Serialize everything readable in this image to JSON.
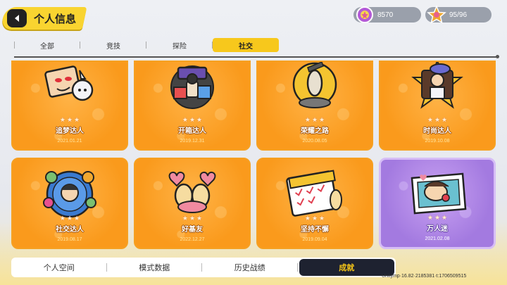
{
  "header": {
    "title": "个人信息"
  },
  "resources": [
    {
      "icon": "gem-badge-icon",
      "value": "8570"
    },
    {
      "icon": "star-token-icon",
      "value": "95/96"
    }
  ],
  "tabs": [
    {
      "label": "全部",
      "active": false
    },
    {
      "label": "竞技",
      "active": false
    },
    {
      "label": "探险",
      "active": false
    },
    {
      "label": "社交",
      "active": true
    }
  ],
  "achievements": [
    {
      "name": "追梦达人",
      "date": "2021.01.21",
      "color": "orange",
      "icon": "dream-chaser-badge-icon"
    },
    {
      "name": "开箱达人",
      "date": "2019.12.31",
      "color": "orange",
      "icon": "box-opener-badge-icon"
    },
    {
      "name": "荣耀之路",
      "date": "2020.08.05",
      "color": "orange",
      "icon": "glory-road-badge-icon"
    },
    {
      "name": "时尚达人",
      "date": "2019.10.08",
      "color": "orange",
      "icon": "fashionista-badge-icon"
    },
    {
      "name": "社交达人",
      "date": "2019.08.17",
      "color": "orange",
      "icon": "social-butterfly-badge-icon"
    },
    {
      "name": "好基友",
      "date": "2022.12.27",
      "color": "orange",
      "icon": "best-buddies-badge-icon"
    },
    {
      "name": "坚持不懈",
      "date": "2019.09.04",
      "color": "orange",
      "icon": "persistence-calendar-badge-icon"
    },
    {
      "name": "万人迷",
      "date": "2021.02.08",
      "color": "purple",
      "icon": "heartthrob-badge-icon"
    }
  ],
  "bottom_nav": [
    {
      "label": "个人空间",
      "active": false
    },
    {
      "label": "模式数据",
      "active": false
    },
    {
      "label": "历史战绩",
      "active": false
    },
    {
      "label": "成就",
      "active": true
    }
  ],
  "debug_text": "Unitymp·16.82·2185381·t:1706509515",
  "colors": {
    "accent_yellow": "#f7c81c",
    "card_orange": "#fa9a1c",
    "card_purple": "#a37ae0",
    "nav_dark": "#1e2230"
  }
}
